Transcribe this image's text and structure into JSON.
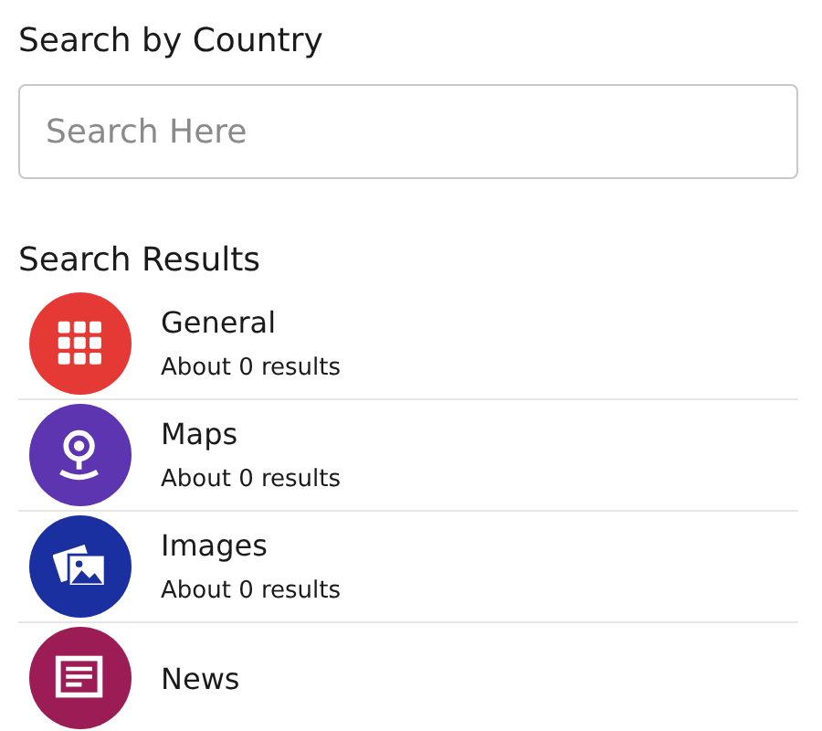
{
  "search_section": {
    "heading": "Search by Country",
    "field": {
      "placeholder": "Search Here"
    }
  },
  "results_section": {
    "heading": "Search Results",
    "items": [
      {
        "kind": "grid",
        "color": "#e53935",
        "title": "General",
        "subtitle": "About 0 results"
      },
      {
        "kind": "pin",
        "color": "#5e35b1",
        "title": "Maps",
        "subtitle": "About 0 results"
      },
      {
        "kind": "images",
        "color": "#1a2fa0",
        "title": "Images",
        "subtitle": "About 0 results"
      },
      {
        "kind": "news",
        "color": "#9c1d55",
        "title": "News"
      }
    ]
  }
}
